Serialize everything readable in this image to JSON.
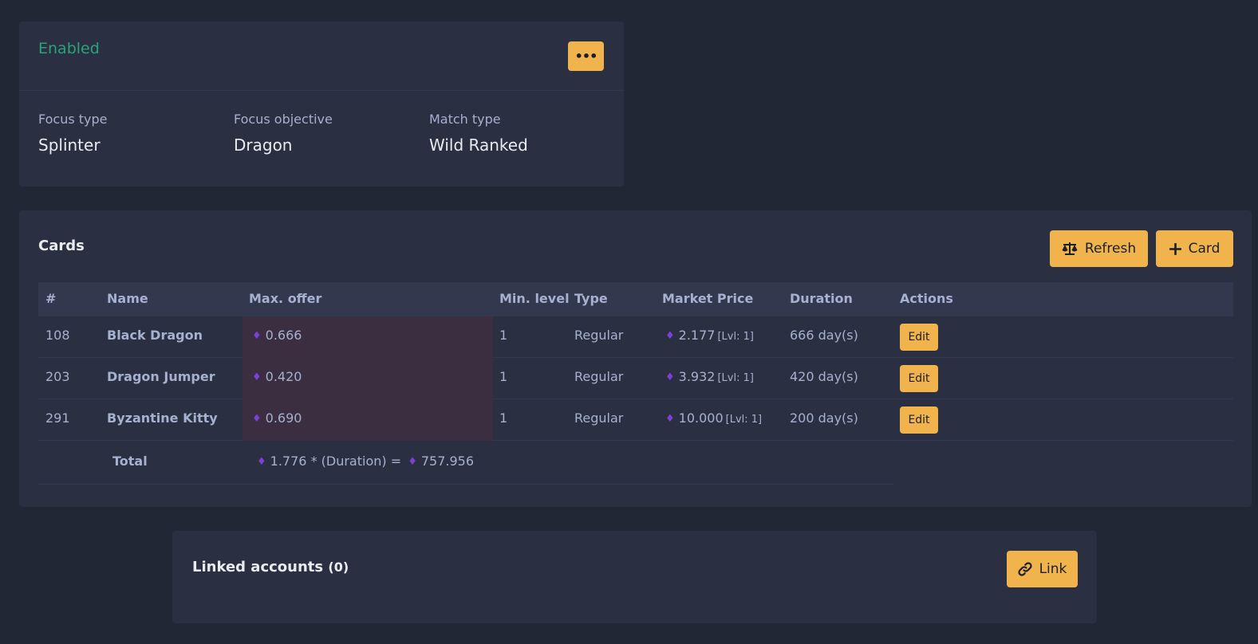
{
  "status": {
    "label": "Enabled",
    "more_label": "•••",
    "fields": [
      {
        "label": "Focus type",
        "value": "Splinter"
      },
      {
        "label": "Focus objective",
        "value": "Dragon"
      },
      {
        "label": "Match type",
        "value": "Wild Ranked"
      }
    ]
  },
  "cards": {
    "title": "Cards",
    "refresh_label": "Refresh",
    "add_label": "Card",
    "columns": [
      "#",
      "Name",
      "Max. offer",
      "Min. level",
      "Type",
      "Market Price",
      "Duration",
      "Actions"
    ],
    "rows": [
      {
        "id": "108",
        "name": "Black Dragon",
        "max_offer": "0.666",
        "min_level": "1",
        "type": "Regular",
        "market_price": "2.177",
        "market_lvl": "[Lvl: 1]",
        "duration": "666 day(s)",
        "action": "Edit"
      },
      {
        "id": "203",
        "name": "Dragon Jumper",
        "max_offer": "0.420",
        "min_level": "1",
        "type": "Regular",
        "market_price": "3.932",
        "market_lvl": "[Lvl: 1]",
        "duration": "420 day(s)",
        "action": "Edit"
      },
      {
        "id": "291",
        "name": "Byzantine Kitty",
        "max_offer": "0.690",
        "min_level": "1",
        "type": "Regular",
        "market_price": "10.000",
        "market_lvl": "[Lvl: 1]",
        "duration": "200 day(s)",
        "action": "Edit"
      }
    ],
    "total": {
      "label": "Total",
      "sum": "1.776",
      "formula": "* (Duration) =",
      "result": "757.956"
    }
  },
  "linked": {
    "title": "Linked accounts",
    "count": "(0)",
    "link_label": "Link"
  },
  "colors": {
    "accent": "#f1b44c",
    "enabled": "#2ba37a",
    "diamond": "#7e3fd8"
  },
  "icons": {
    "more": "more-dots-icon",
    "refresh": "balance-scale-icon",
    "add": "plus-icon",
    "link": "link-icon",
    "currency": "diamond-icon"
  }
}
